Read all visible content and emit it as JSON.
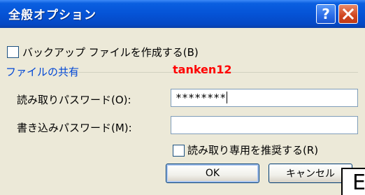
{
  "window": {
    "title": "全般オプション",
    "help_glyph": "?",
    "close_icon": "close-icon"
  },
  "options": {
    "backup_label": "バックアップ ファイルを作成する(B)",
    "backup_checked": false
  },
  "sharing": {
    "group_title": "ファイルの共有",
    "annotation": "tanken12",
    "read_password_label": "読み取りパスワード(O):",
    "read_password_value": "********",
    "write_password_label": "書き込みパスワード(M):",
    "write_password_value": "",
    "readonly_label": "読み取り専用を推奨する(R)",
    "readonly_checked": false
  },
  "buttons": {
    "ok_label": "OK",
    "cancel_label": "キャンセル"
  },
  "overlay": {
    "letter": "E"
  },
  "colors": {
    "titlebar": "#0553d6",
    "group_title": "#0046d5",
    "annotation": "#ff0000",
    "close_button": "#d0451e"
  }
}
